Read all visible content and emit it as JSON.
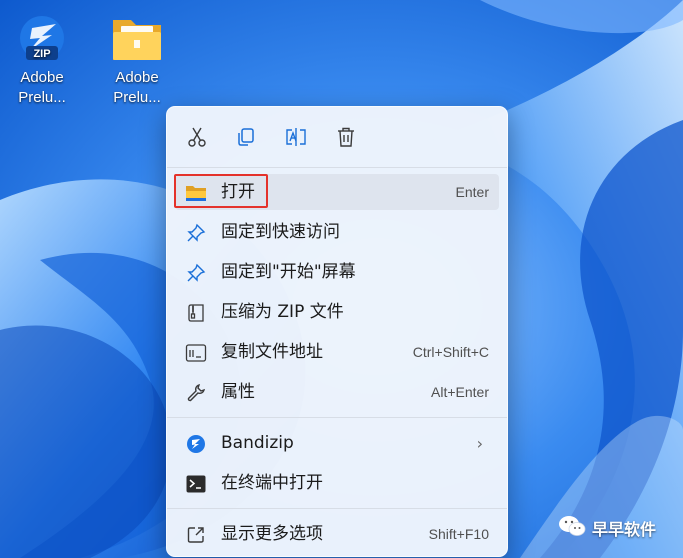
{
  "desktop": {
    "icons": [
      {
        "name": "Adobe\nPrelu...",
        "type": "zip-file-icon"
      },
      {
        "name": "Adobe\nPrelu...",
        "type": "folder-icon"
      }
    ]
  },
  "context_menu": {
    "toolbar": [
      "cut-icon",
      "copy-icon",
      "rename-icon",
      "delete-icon"
    ],
    "items": [
      {
        "label": "打开",
        "shortcut": "Enter",
        "icon": "folder-open-icon",
        "highlighted": true
      },
      {
        "label": "固定到快速访问",
        "shortcut": "",
        "icon": "pin-icon"
      },
      {
        "label": "固定到\"开始\"屏幕",
        "shortcut": "",
        "icon": "pin-icon"
      },
      {
        "label": "压缩为 ZIP 文件",
        "shortcut": "",
        "icon": "zip-compress-icon"
      },
      {
        "label": "复制文件地址",
        "shortcut": "Ctrl+Shift+C",
        "icon": "copy-path-icon"
      },
      {
        "label": "属性",
        "shortcut": "Alt+Enter",
        "icon": "wrench-icon"
      },
      {
        "label": "Bandizip",
        "shortcut": "",
        "icon": "bandizip-icon",
        "submenu": true
      },
      {
        "label": "在终端中打开",
        "shortcut": "",
        "icon": "terminal-icon"
      },
      {
        "label": "显示更多选项",
        "shortcut": "Shift+F10",
        "icon": "more-options-icon"
      }
    ]
  },
  "watermark": {
    "text": "早早软件",
    "icon": "wechat-icon"
  },
  "colors": {
    "highlight_border": "#e4322b",
    "accent": "#1a6fd8",
    "menu_bg": "#f0f5fc"
  }
}
